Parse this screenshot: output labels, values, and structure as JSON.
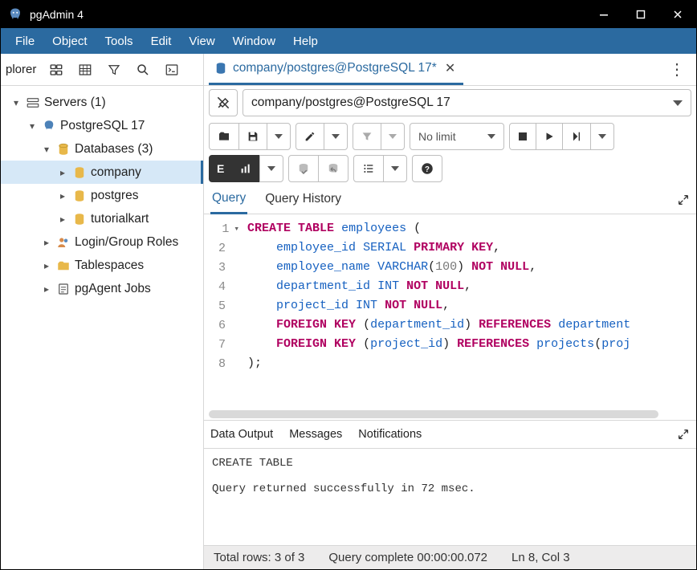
{
  "window": {
    "title": "pgAdmin 4"
  },
  "menu": {
    "file": "File",
    "object": "Object",
    "tools": "Tools",
    "edit": "Edit",
    "view": "View",
    "window": "Window",
    "help": "Help"
  },
  "sidebar": {
    "title": "plorer",
    "tree": {
      "servers": "Servers (1)",
      "pg": "PostgreSQL 17",
      "databases": "Databases (3)",
      "db_company": "company",
      "db_postgres": "postgres",
      "db_tutorialkart": "tutorialkart",
      "login_roles": "Login/Group Roles",
      "tablespaces": "Tablespaces",
      "pgagent": "pgAgent Jobs"
    }
  },
  "tab": {
    "title": "company/postgres@PostgreSQL 17*"
  },
  "connection": {
    "value": "company/postgres@PostgreSQL 17"
  },
  "toolbar": {
    "limit": "No limit"
  },
  "editor_tabs": {
    "query": "Query",
    "history": "Query History"
  },
  "sql": {
    "l1a": "CREATE",
    "l1b": "TABLE",
    "l1c": "employees",
    "l1d": "(",
    "l2a": "employee_id",
    "l2b": "SERIAL",
    "l2c": "PRIMARY",
    "l2d": "KEY",
    "l2e": ",",
    "l3a": "employee_name",
    "l3b": "VARCHAR",
    "l3c": "(",
    "l3d": "100",
    "l3e": ")",
    "l3f": "NOT",
    "l3g": "NULL",
    "l3h": ",",
    "l4a": "department_id",
    "l4b": "INT",
    "l4c": "NOT",
    "l4d": "NULL",
    "l4e": ",",
    "l5a": "project_id",
    "l5b": "INT",
    "l5c": "NOT",
    "l5d": "NULL",
    "l5e": ",",
    "l6a": "FOREIGN",
    "l6b": "KEY",
    "l6c": "(",
    "l6d": "department_id",
    "l6e": ")",
    "l6f": "REFERENCES",
    "l6g": "department",
    "l7a": "FOREIGN",
    "l7b": "KEY",
    "l7c": "(",
    "l7d": "project_id",
    "l7e": ")",
    "l7f": "REFERENCES",
    "l7g": "projects",
    "l7h": "(",
    "l7i": "proj",
    "l8a": ");"
  },
  "gutter": {
    "n1": "1",
    "n2": "2",
    "n3": "3",
    "n4": "4",
    "n5": "5",
    "n6": "6",
    "n7": "7",
    "n8": "8"
  },
  "out_tabs": {
    "data": "Data Output",
    "messages": "Messages",
    "notifications": "Notifications"
  },
  "messages": {
    "line1": "CREATE TABLE",
    "line2": "Query returned successfully in 72 msec."
  },
  "status": {
    "rows": "Total rows: 3 of 3",
    "time": "Query complete 00:00:00.072",
    "pos": "Ln 8, Col 3"
  }
}
